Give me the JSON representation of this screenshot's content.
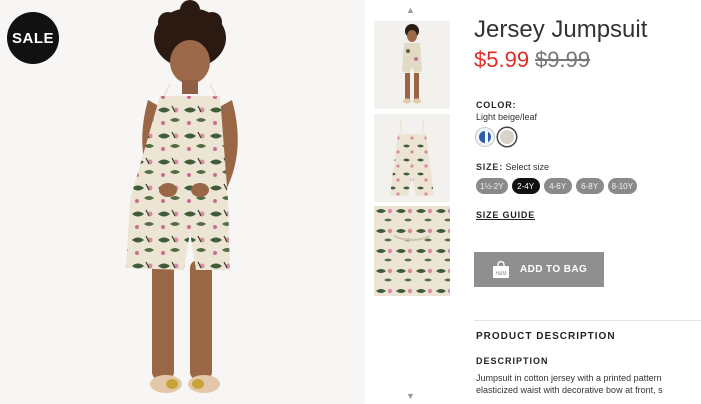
{
  "badge": {
    "text": "SALE"
  },
  "gallery": {
    "up_arrow": "▲",
    "down_arrow": "▼"
  },
  "product": {
    "title": "Jersey Jumpsuit",
    "price_sale": "$5.99",
    "price_original": "$9.99",
    "color_label": "COLOR:",
    "color_name": "Light beige/leaf",
    "size_label": "SIZE:",
    "size_prompt": "Select size",
    "sizes": [
      "1½-2Y",
      "2-4Y",
      "4-6Y",
      "6-8Y",
      "8-10Y"
    ],
    "selected_size": "2-4Y",
    "size_guide": "SIZE GUIDE",
    "add_to_bag": "ADD TO BAG",
    "bag_icon_text": "H&M"
  },
  "description": {
    "section_heading": "PRODUCT DESCRIPTION",
    "heading": "DESCRIPTION",
    "line1": "Jumpsuit in cotton jersey with a printed pattern",
    "line2": "elasticized waist with decorative bow at front, s"
  },
  "colors": {
    "sale_red": "#e12b27",
    "button_grey": "#8f8f8f",
    "selected_size": "#111111"
  }
}
